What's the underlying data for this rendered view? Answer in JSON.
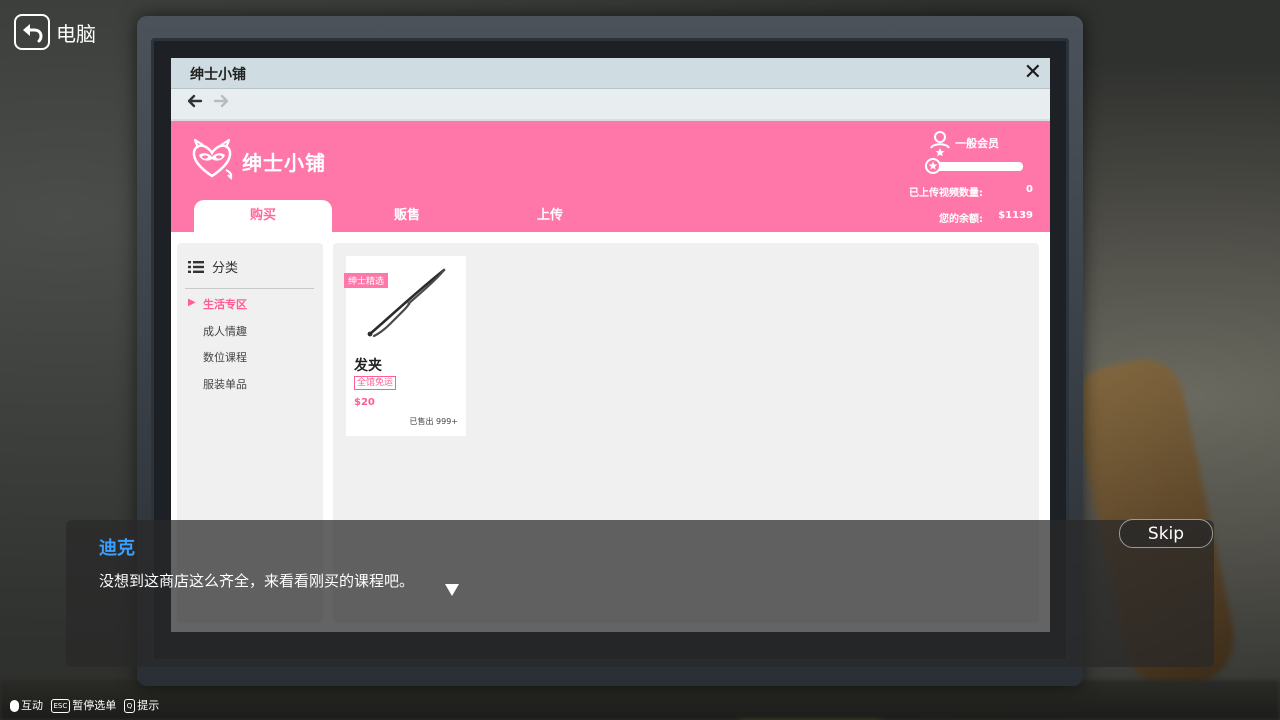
{
  "game": {
    "back_label": "电脑",
    "hints": [
      {
        "key": "",
        "label": "互动"
      },
      {
        "key": "ESC",
        "label": "暂停选单"
      },
      {
        "key": "Q",
        "label": "提示"
      }
    ]
  },
  "window": {
    "title": "绅士小铺",
    "close_icon": "close-icon",
    "back_icon": "arrow-left-icon",
    "forward_icon": "arrow-right-icon"
  },
  "shop": {
    "name": "绅士小铺",
    "logo_icon": "devil-heart-mask-icon",
    "accent_color": "#ff77a9",
    "member": {
      "level_label": "一般会员",
      "progress": 0
    },
    "stats": [
      {
        "label": "已上传视频数量:",
        "value": "0"
      },
      {
        "label": "您的余额:",
        "value": "$1139"
      }
    ],
    "tabs": [
      "购买",
      "贩售",
      "上传"
    ],
    "active_tab": "购买"
  },
  "sidebar": {
    "heading": "分类",
    "items": [
      "生活专区",
      "成人情趣",
      "数位课程",
      "服装单品"
    ],
    "active_item": "生活专区"
  },
  "products": [
    {
      "badge": "绅士精选",
      "name": "发夹",
      "shipping": "全馆免运",
      "price": "$20",
      "sold": "已售出 999+",
      "image": "hairpin"
    }
  ],
  "dialogue": {
    "speaker": "迪克",
    "speaker_color": "#3aa0ff",
    "line": "没想到这商店这么齐全，来看看刚买的课程吧。",
    "skip_label": "Skip"
  }
}
